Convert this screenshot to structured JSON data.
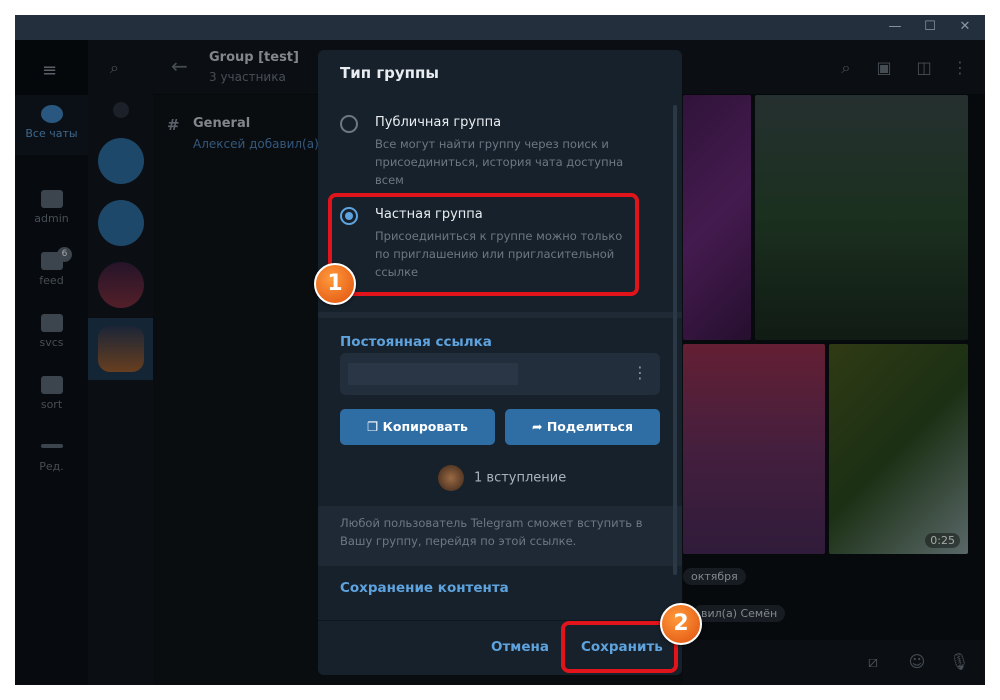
{
  "window": {
    "controls": [
      "minimize",
      "maximize",
      "close"
    ]
  },
  "folders": [
    {
      "label": "Все чаты",
      "icon": "chats-icon",
      "active": true
    },
    {
      "label": "admin",
      "icon": "folder-icon"
    },
    {
      "label": "feed",
      "icon": "folder-icon",
      "badge": "6"
    },
    {
      "label": "svcs",
      "icon": "folder-icon"
    },
    {
      "label": "sort",
      "icon": "folder-icon"
    },
    {
      "label": "Ред.",
      "icon": "sliders-icon"
    }
  ],
  "header": {
    "title": "Group [test]",
    "subtitle": "3 участника"
  },
  "topic": {
    "name": "General",
    "preview": "Алексей добавил(а) С"
  },
  "chat": {
    "video_duration": "0:25",
    "date_chip": "октября",
    "service_msg": "вил(а) Семён"
  },
  "dialog": {
    "title": "Тип группы",
    "options": [
      {
        "label": "Публичная группа",
        "desc": "Все могут найти группу через поиск и присоединиться, история чата доступна всем",
        "selected": false
      },
      {
        "label": "Частная группа",
        "desc": "Присоединиться к группе можно только по приглашению или пригласительной ссылке",
        "selected": true
      }
    ],
    "link_section": "Постоянная ссылка",
    "copy": "Копировать",
    "share": "Поделиться",
    "joins": "1 вступление",
    "note": "Любой пользователь Telegram сможет вступить в Вашу группу, перейдя по этой ссылке.",
    "content_section": "Сохранение контента",
    "cancel": "Отмена",
    "save": "Сохранить"
  },
  "annotations": [
    "1",
    "2"
  ],
  "colors": {
    "accent": "#5ea3de",
    "button": "#2f6ea5",
    "highlight": "#e0141a",
    "marker": "#f07a20"
  }
}
